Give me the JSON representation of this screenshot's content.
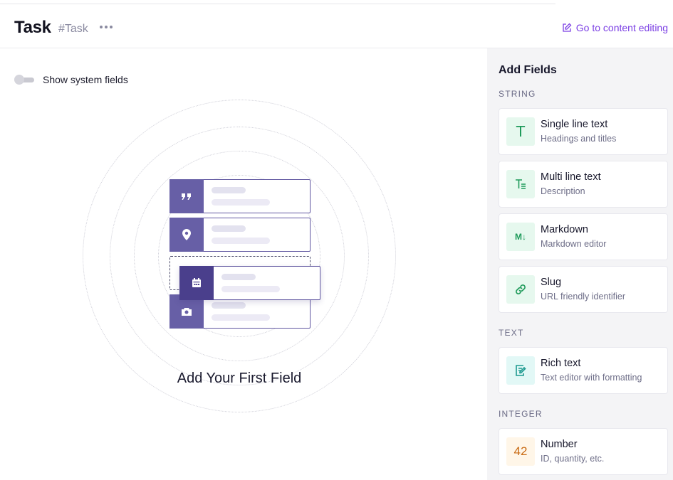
{
  "header": {
    "title": "Task",
    "tag": "#Task",
    "goto_label": "Go to content editing"
  },
  "main": {
    "toggle_label": "Show system fields",
    "toggle_on": false,
    "empty_title": "Add Your First Field"
  },
  "panel": {
    "title": "Add Fields",
    "sections": [
      {
        "label": "STRING"
      },
      {
        "label": "TEXT"
      },
      {
        "label": "INTEGER"
      }
    ],
    "fields": [
      {
        "name": "Single line text",
        "desc": "Headings and titles",
        "icon": "single-line-text-icon"
      },
      {
        "name": "Multi line text",
        "desc": "Description",
        "icon": "multi-line-text-icon"
      },
      {
        "name": "Markdown",
        "desc": "Markdown editor",
        "icon": "markdown-icon"
      },
      {
        "name": "Slug",
        "desc": "URL friendly identifier",
        "icon": "link-icon"
      },
      {
        "name": "Rich text",
        "desc": "Text editor with formatting",
        "icon": "rich-text-edit-icon"
      },
      {
        "name": "Number",
        "desc": "ID, quantity, etc.",
        "icon": "number-icon",
        "icon_text": "42"
      }
    ],
    "markdown_glyph": "M↓",
    "single_glyph": "T"
  },
  "colors": {
    "accent": "#7b3fe4",
    "illustration": "#675fa6"
  }
}
